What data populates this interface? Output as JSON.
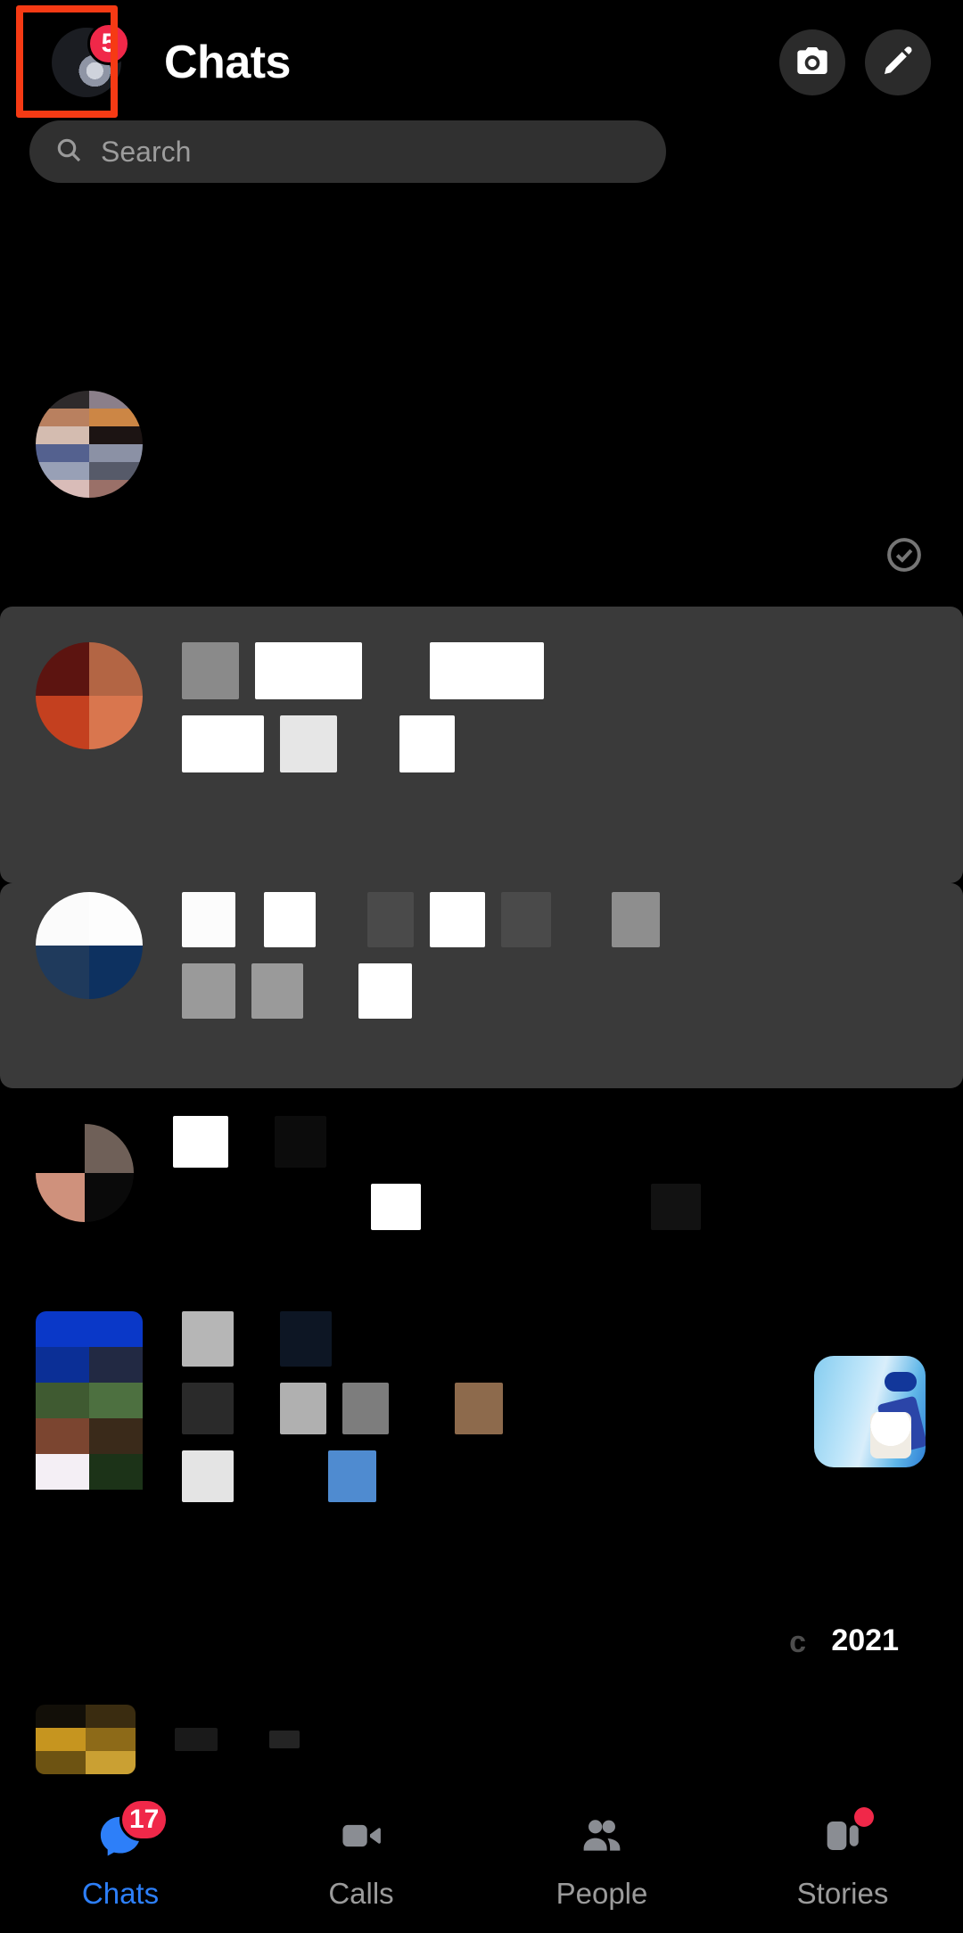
{
  "header": {
    "title": "Chats",
    "avatar": {
      "name": "profile-avatar",
      "badge_count": "5"
    },
    "camera_icon": "camera-icon",
    "compose_icon": "pencil-compose-icon",
    "annotation_color": "#f63a14"
  },
  "search": {
    "placeholder": "Search",
    "icon": "search-icon",
    "value": ""
  },
  "content": {
    "redacted_note": "",
    "selected_row_icon": "check-circle-icon",
    "year_label": "2021",
    "year_prefix": "c",
    "thumbnail_name": "product-photo-thumbnail"
  },
  "bottom_nav": {
    "items": [
      {
        "label": "Chats",
        "icon": "chat-bubble-icon",
        "active": true,
        "badge": "17",
        "dot": false
      },
      {
        "label": "Calls",
        "icon": "video-camera-icon",
        "active": false,
        "badge": "",
        "dot": false
      },
      {
        "label": "People",
        "icon": "people-icon",
        "active": false,
        "badge": "",
        "dot": false
      },
      {
        "label": "Stories",
        "icon": "stories-icon",
        "active": false,
        "badge": "",
        "dot": true
      }
    ]
  },
  "colors": {
    "accent_blue": "#2d7ff9",
    "badge_red": "#f02849",
    "annotation_red": "#f63a14",
    "surface": "#303030",
    "highlight": "#3a3a3a",
    "background": "#000000"
  }
}
